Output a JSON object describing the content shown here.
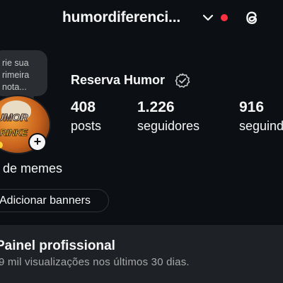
{
  "header": {
    "username": "humordiferenci...",
    "chevron_icon": "chevron-down-icon",
    "notification_dot_color": "#ff3040",
    "threads_icon": "threads-icon"
  },
  "note": {
    "lines": [
      "rie sua",
      "rimeira",
      "nota..."
    ]
  },
  "avatar": {
    "text_line1": "HUMOR",
    "text_line2": "GRINKE"
  },
  "profile": {
    "display_name": "Reserva Humor",
    "verified_icon": "verified-badge-icon",
    "bio": "de memes"
  },
  "stats": [
    {
      "value": "408",
      "label": "posts"
    },
    {
      "value": "1.226",
      "label": "seguidores"
    },
    {
      "value": "916",
      "label": "seguindo"
    }
  ],
  "actions": {
    "add_banners_label": "Adicionar banners"
  },
  "professional_panel": {
    "title": "Painel profissional",
    "subtitle": "9 mil visualizações nos últimos 30 dias."
  },
  "colors": {
    "background": "#0c1014",
    "panel": "#1e2125",
    "text": "#f5f5f5",
    "muted_text": "#a8a8a8"
  }
}
